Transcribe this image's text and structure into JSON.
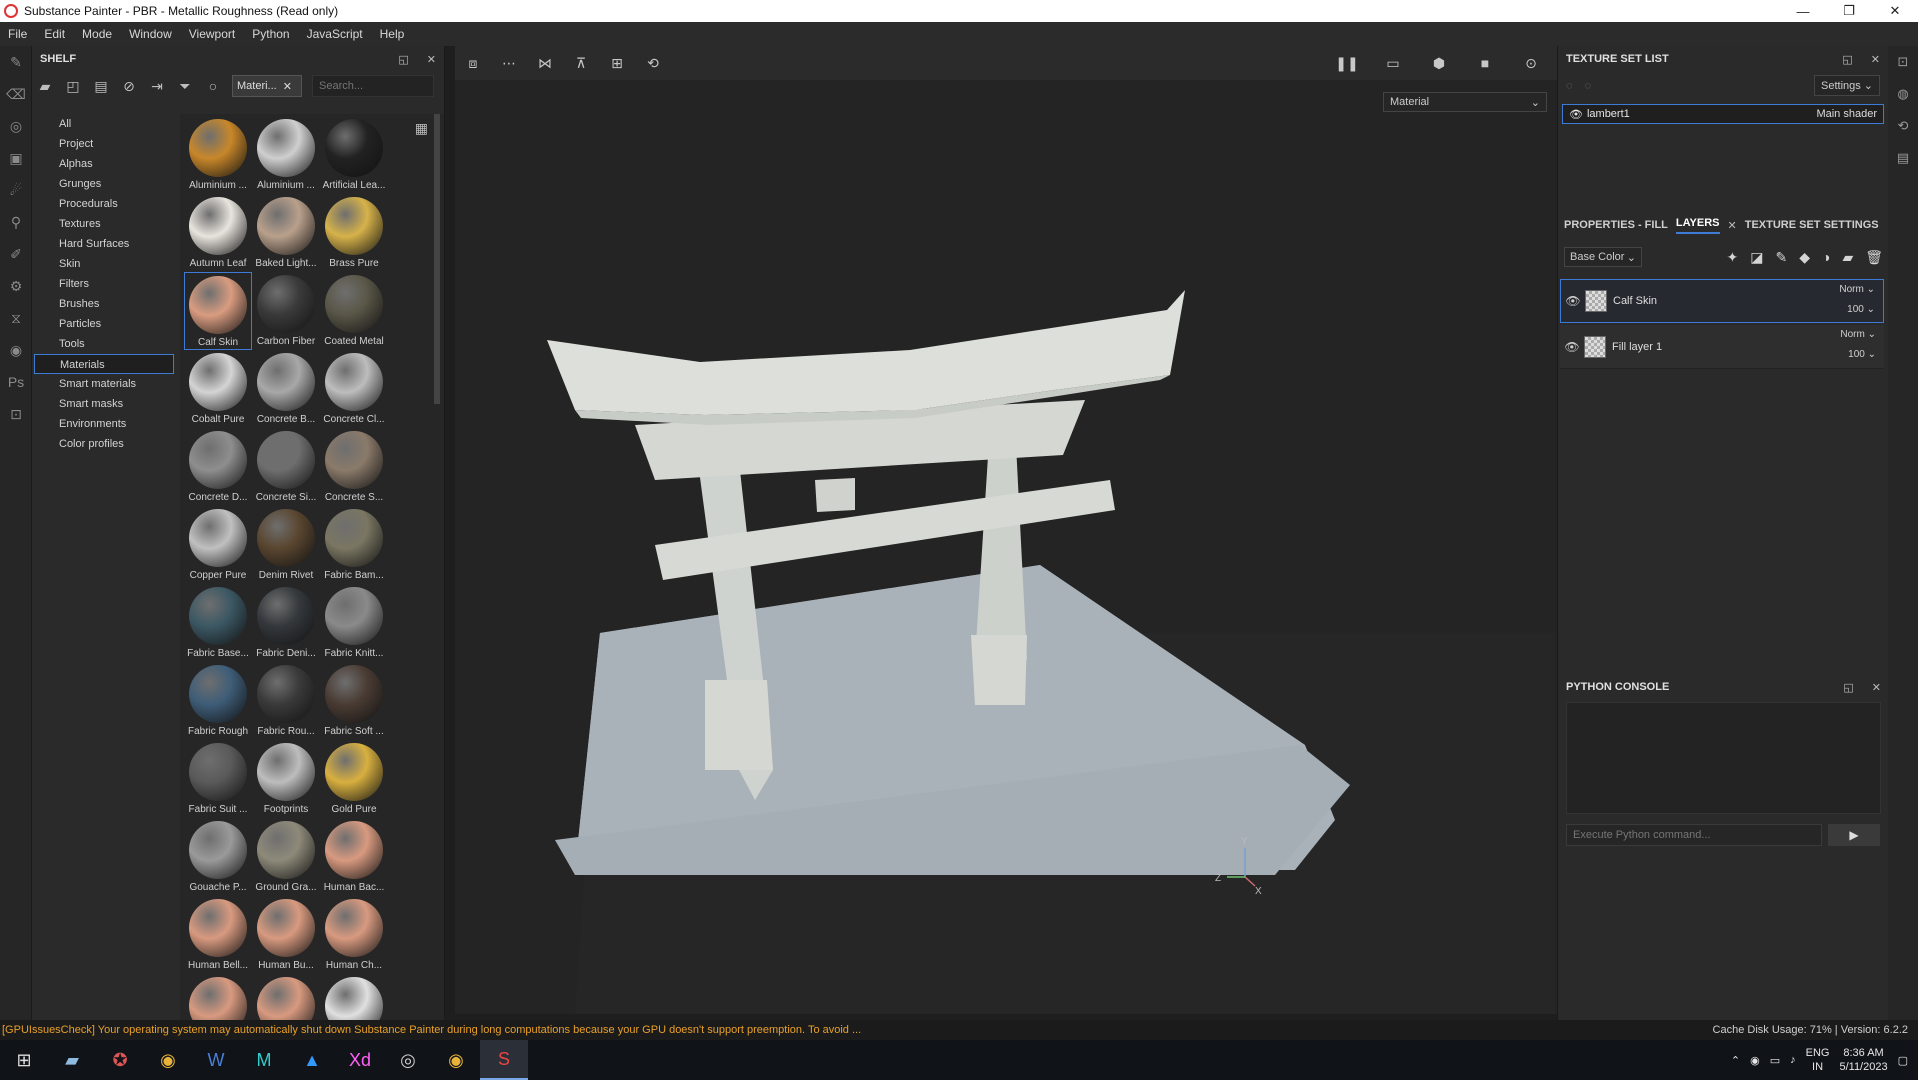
{
  "window": {
    "title": "Substance Painter - PBR - Metallic Roughness (Read only)",
    "controls": [
      "—",
      "❐",
      "✕"
    ]
  },
  "menu": [
    "File",
    "Edit",
    "Mode",
    "Window",
    "Viewport",
    "Python",
    "JavaScript",
    "Help"
  ],
  "shelf": {
    "title": "SHELF",
    "filter_chip": "Materi...",
    "search_placeholder": "Search...",
    "categories": [
      "All",
      "Project",
      "Alphas",
      "Grunges",
      "Procedurals",
      "Textures",
      "Hard Surfaces",
      "Skin",
      "Filters",
      "Brushes",
      "Particles",
      "Tools",
      "Materials",
      "Smart materials",
      "Smart masks",
      "Environments",
      "Color profiles"
    ],
    "selected_category": "Materials",
    "materials": [
      {
        "label": "Aluminium ...",
        "color": "#c8872a"
      },
      {
        "label": "Aluminium ...",
        "color": "#cfcfcf"
      },
      {
        "label": "Artificial Lea...",
        "color": "#222222"
      },
      {
        "label": "Autumn Leaf",
        "color": "#e8e4de"
      },
      {
        "label": "Baked Light...",
        "color": "#b9a08c"
      },
      {
        "label": "Brass Pure",
        "color": "#d6b24a"
      },
      {
        "label": "Calf Skin",
        "color": "#d99c80"
      },
      {
        "label": "Carbon Fiber",
        "color": "#3a3a3a"
      },
      {
        "label": "Coated Metal",
        "color": "#5a5748"
      },
      {
        "label": "Cobalt Pure",
        "color": "#d4d4d4"
      },
      {
        "label": "Concrete B...",
        "color": "#a8a8a8"
      },
      {
        "label": "Concrete Cl...",
        "color": "#bdbdbd"
      },
      {
        "label": "Concrete D...",
        "color": "#8e8e8e"
      },
      {
        "label": "Concrete Si...",
        "color": "#6e6e6e"
      },
      {
        "label": "Concrete S...",
        "color": "#8a7a6a"
      },
      {
        "label": "Copper Pure",
        "color": "#c0c0c0"
      },
      {
        "label": "Denim Rivet",
        "color": "#5a4630"
      },
      {
        "label": "Fabric Bam...",
        "color": "#7a7662"
      },
      {
        "label": "Fabric Base...",
        "color": "#3c5864"
      },
      {
        "label": "Fabric Deni...",
        "color": "#34383c"
      },
      {
        "label": "Fabric Knitt...",
        "color": "#8a8a8a"
      },
      {
        "label": "Fabric Rough",
        "color": "#3e5d78"
      },
      {
        "label": "Fabric Rou...",
        "color": "#3a3a3a"
      },
      {
        "label": "Fabric Soft ...",
        "color": "#4a3c34"
      },
      {
        "label": "Fabric Suit ...",
        "color": "#5a5a5a"
      },
      {
        "label": "Footprints",
        "color": "#bdbdbd"
      },
      {
        "label": "Gold Pure",
        "color": "#d8b040"
      },
      {
        "label": "Gouache P...",
        "color": "#9a9a9a"
      },
      {
        "label": "Ground Gra...",
        "color": "#8e8a7a"
      },
      {
        "label": "Human Bac...",
        "color": "#d89a80"
      },
      {
        "label": "Human Bell...",
        "color": "#d89a80"
      },
      {
        "label": "Human Bu...",
        "color": "#d89a80"
      },
      {
        "label": "Human Ch...",
        "color": "#d89a80"
      },
      {
        "label": "",
        "color": "#d89a80"
      },
      {
        "label": "",
        "color": "#d89a80"
      },
      {
        "label": "",
        "color": "#e0e0e0"
      }
    ],
    "selected_material": "Calf Skin"
  },
  "viewport": {
    "mode": "Material"
  },
  "texture_set_list": {
    "title": "TEXTURE SET LIST",
    "settings_label": "Settings",
    "set_name": "lambert1",
    "shader": "Main shader"
  },
  "tabs": [
    "PROPERTIES - FILL",
    "LAYERS",
    "TEXTURE SET SETTINGS"
  ],
  "active_tab": "LAYERS",
  "layers": {
    "channel": "Base Color",
    "items": [
      {
        "name": "Calf Skin",
        "blend": "Norm",
        "opacity": "100"
      },
      {
        "name": "Fill layer 1",
        "blend": "Norm",
        "opacity": "100"
      }
    ]
  },
  "console": {
    "title": "PYTHON CONSOLE",
    "placeholder": "Execute Python command..."
  },
  "status": {
    "message": "[GPUIssuesCheck] Your operating system may automatically shut down Substance Painter during long computations because your GPU doesn't support preemption. To avoid ...",
    "cache": "Cache Disk Usage:   71% | Version: 6.2.2"
  },
  "taskbar": {
    "lang_top": "ENG",
    "lang_bottom": "IN",
    "time": "8:36 AM",
    "date": "5/11/2023"
  },
  "colors": {
    "accent": "#3d7bd6",
    "warning": "#e8a02a"
  }
}
